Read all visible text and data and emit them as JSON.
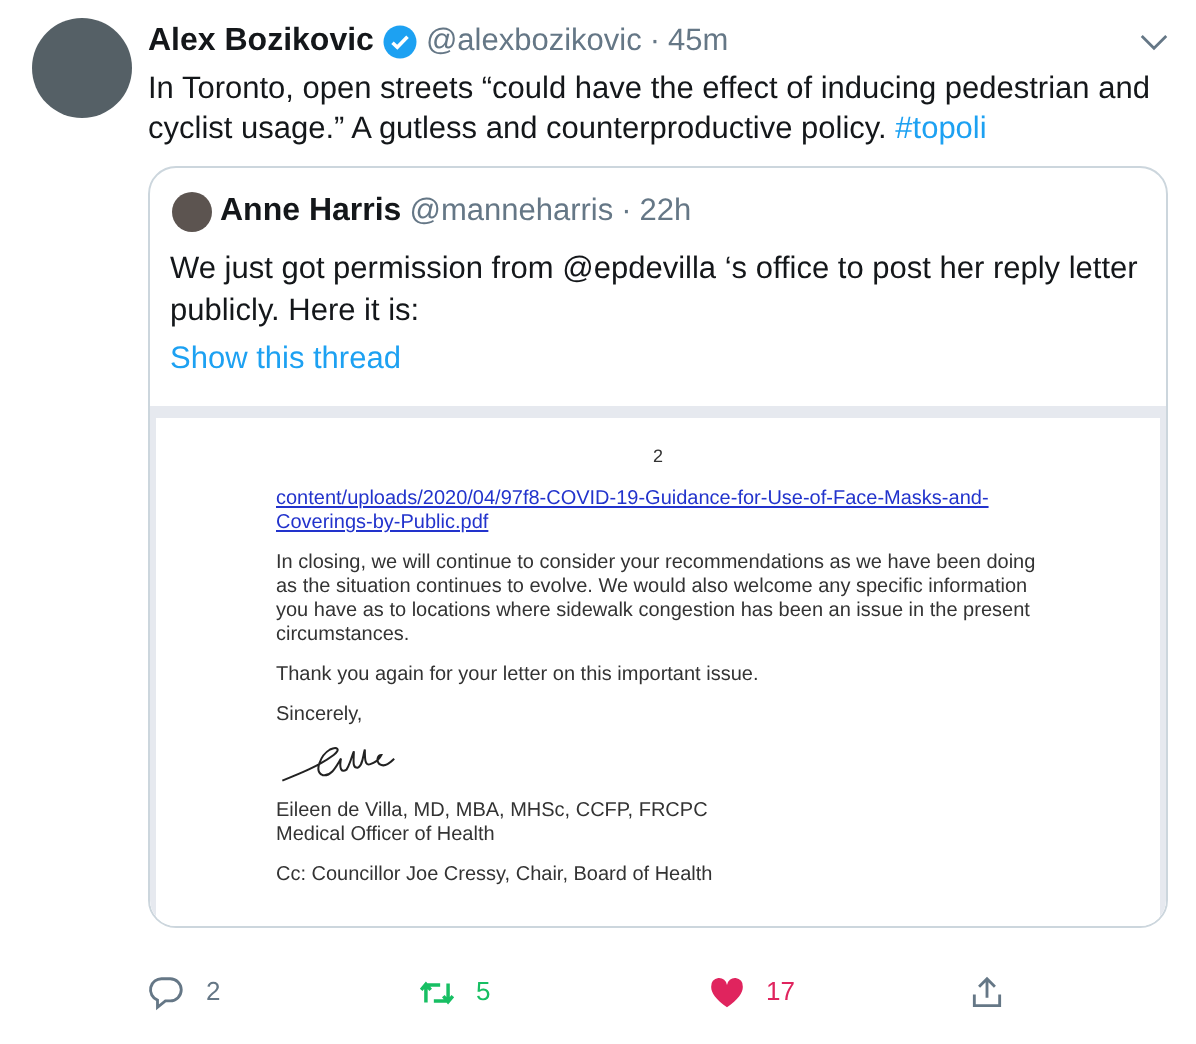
{
  "tweet": {
    "author": {
      "name": "Alex Bozikovic",
      "verified": true,
      "handle": "@alexbozikovic",
      "separator": "·",
      "time": "45m"
    },
    "text": "In Toronto, open streets “could have the effect of inducing pedestrian and cyclist usage.” A gutless and counterproductive policy.",
    "hashtag": "#topoli",
    "quoted": {
      "author": {
        "name": "Anne Harris",
        "handle": "@manneharris",
        "separator": "·",
        "time": "22h"
      },
      "text": "We just got permission from @epdevilla ‘s office to post her reply letter publicly. Here it is:",
      "thread_link": "Show this thread",
      "document": {
        "page_number": "2",
        "link": "content/uploads/2020/04/97f8-COVID-19-Guidance-for-Use-of-Face-Masks-and-Coverings-by-Public.pdf",
        "paragraphs": [
          "In closing, we will continue to consider your recommendations as we have been doing as the situation continues to evolve. We would also welcome any specific information you have as to locations where sidewalk congestion has been an issue in the present circumstances.",
          "Thank you again for your letter on this important issue.",
          "Sincerely,"
        ],
        "signature_lines": [
          "Eileen de Villa, MD, MBA, MHSc, CCFP, FRCPC",
          "Medical Officer of Health"
        ],
        "cc": "Cc: Councillor Joe Cressy, Chair, Board of Health"
      }
    },
    "actions": [
      {
        "kind": "reply",
        "count": "2",
        "active": false
      },
      {
        "kind": "retweet",
        "count": "5",
        "active": true
      },
      {
        "kind": "like",
        "count": "17",
        "active": true
      },
      {
        "kind": "share",
        "active": false
      }
    ]
  }
}
